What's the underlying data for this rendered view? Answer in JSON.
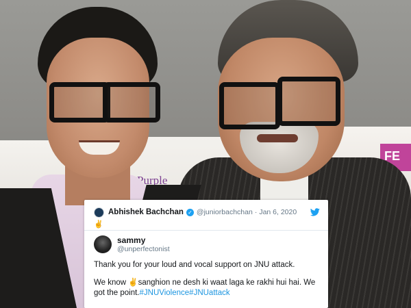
{
  "photo": {
    "banner_text": "Purple\nRibbon",
    "banner_pink_text": "FE"
  },
  "tweet": {
    "author_name": "Abhishek Bachchan",
    "author_handle": "@juniorbachchan",
    "separator": "·",
    "date": "Jan 6, 2020",
    "emoji": "✌",
    "verified_icon": "verified-badge-icon",
    "platform_icon": "twitter-bird-icon",
    "quoted": {
      "name": "sammy",
      "handle": "@unperfectonist",
      "line1": "Thank you for your loud and vocal support on JNU attack.",
      "line2_prefix": "We know ✌sanghion ne desh ki waat laga ke rakhi hui hai. We got the point.",
      "hashtag1": "#JNUViolence",
      "hashtag2": "#JNUattack"
    }
  },
  "colors": {
    "link": "#1b95e0",
    "verified": "#1da1f2"
  }
}
